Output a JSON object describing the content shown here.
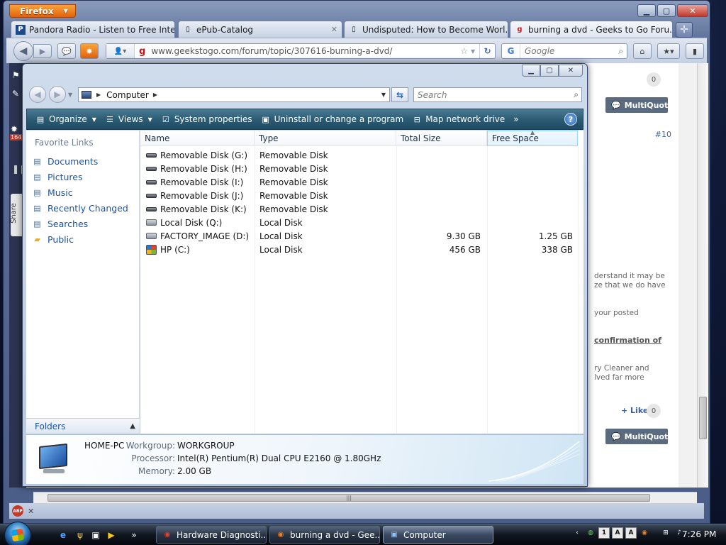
{
  "firefox": {
    "menu_label": "Firefox",
    "tabs": [
      {
        "label": "Pandora Radio - Listen to Free Inte...",
        "icon": "P"
      },
      {
        "label": "ePub-Catalog",
        "icon": ""
      },
      {
        "label": "Undisputed: How to Become Worl...",
        "icon": ""
      },
      {
        "label": "burning a dvd - Geeks to Go Foru...",
        "icon": "g"
      }
    ],
    "url": "www.geekstogo.com/forum/topic/307616-burning-a-dvd/",
    "site_icon": "g",
    "search_placeholder": "Google",
    "search_engine_icon": "G",
    "forum": {
      "count_top": "0",
      "multiquote": "MultiQuote",
      "post_number": "#10",
      "text_lines": [
        "derstand it may be",
        "ze that we do have",
        "your posted"
      ],
      "link_text": "confirmation of",
      "text_lines_2": [
        "ry Cleaner and",
        "lved far more"
      ],
      "like_label": "+ Like",
      "like_count": "0",
      "multiquote_2": "MultiQuote"
    },
    "side_badge": "164",
    "share_label": "Share"
  },
  "explorer": {
    "address": "Computer",
    "search_placeholder": "Search",
    "commands": [
      {
        "label": "Organize",
        "dropdown": true,
        "icon": "organize-icon"
      },
      {
        "label": "Views",
        "dropdown": true,
        "icon": "views-icon"
      },
      {
        "label": "System properties",
        "dropdown": false,
        "icon": "system-properties-icon"
      },
      {
        "label": "Uninstall or change a program",
        "dropdown": false,
        "icon": "uninstall-icon"
      },
      {
        "label": "Map network drive",
        "dropdown": false,
        "icon": "map-network-drive-icon"
      }
    ],
    "more_commands": "»",
    "help": "?",
    "favorite_links_title": "Favorite Links",
    "favorite_links": [
      {
        "label": "Documents",
        "icon": "documents-icon"
      },
      {
        "label": "Pictures",
        "icon": "pictures-icon"
      },
      {
        "label": "Music",
        "icon": "music-icon"
      },
      {
        "label": "Recently Changed",
        "icon": "recently-changed-icon"
      },
      {
        "label": "Searches",
        "icon": "searches-icon"
      },
      {
        "label": "Public",
        "icon": "public-icon"
      }
    ],
    "folders_label": "Folders",
    "columns": {
      "name": "Name",
      "type": "Type",
      "total_size": "Total Size",
      "free_space": "Free Space"
    },
    "sorted_column": "free_space",
    "drives": [
      {
        "name": "Removable Disk (G:)",
        "type": "Removable Disk",
        "total": "",
        "free": "",
        "kind": "removable"
      },
      {
        "name": "Removable Disk (H:)",
        "type": "Removable Disk",
        "total": "",
        "free": "",
        "kind": "removable"
      },
      {
        "name": "Removable Disk (I:)",
        "type": "Removable Disk",
        "total": "",
        "free": "",
        "kind": "removable"
      },
      {
        "name": "Removable Disk (J:)",
        "type": "Removable Disk",
        "total": "",
        "free": "",
        "kind": "removable"
      },
      {
        "name": "Removable Disk (K:)",
        "type": "Removable Disk",
        "total": "",
        "free": "",
        "kind": "removable"
      },
      {
        "name": "Local Disk (Q:)",
        "type": "Local Disk",
        "total": "",
        "free": "",
        "kind": "local"
      },
      {
        "name": "FACTORY_IMAGE (D:)",
        "type": "Local Disk",
        "total": "9.30 GB",
        "free": "1.25 GB",
        "kind": "local"
      },
      {
        "name": "HP (C:)",
        "type": "Local Disk",
        "total": "456 GB",
        "free": "338 GB",
        "kind": "system"
      }
    ],
    "details": {
      "computer_name": "HOME-PC",
      "workgroup_label": "Workgroup:",
      "workgroup": "WORKGROUP",
      "processor_label": "Processor:",
      "processor": "Intel(R) Pentium(R) Dual  CPU  E2160  @ 1.80GHz",
      "memory_label": "Memory:",
      "memory": "2.00 GB"
    }
  },
  "taskbar": {
    "quick_launch_more": "»",
    "buttons": [
      {
        "label": "Hardware Diagnosti...",
        "icon": "hardware-diagnostics-icon"
      },
      {
        "label": "burning a dvd - Gee...",
        "icon": "firefox-icon"
      },
      {
        "label": "Computer",
        "icon": "computer-icon"
      }
    ],
    "tray_chevron": "‹",
    "tray_boxes": [
      "1",
      "A",
      "A"
    ],
    "clock": "7:26 PM"
  },
  "colors": {
    "firefox_orange": "#e3620b",
    "link_blue": "#1a55a8",
    "cmdbar": "#2d5c75"
  }
}
